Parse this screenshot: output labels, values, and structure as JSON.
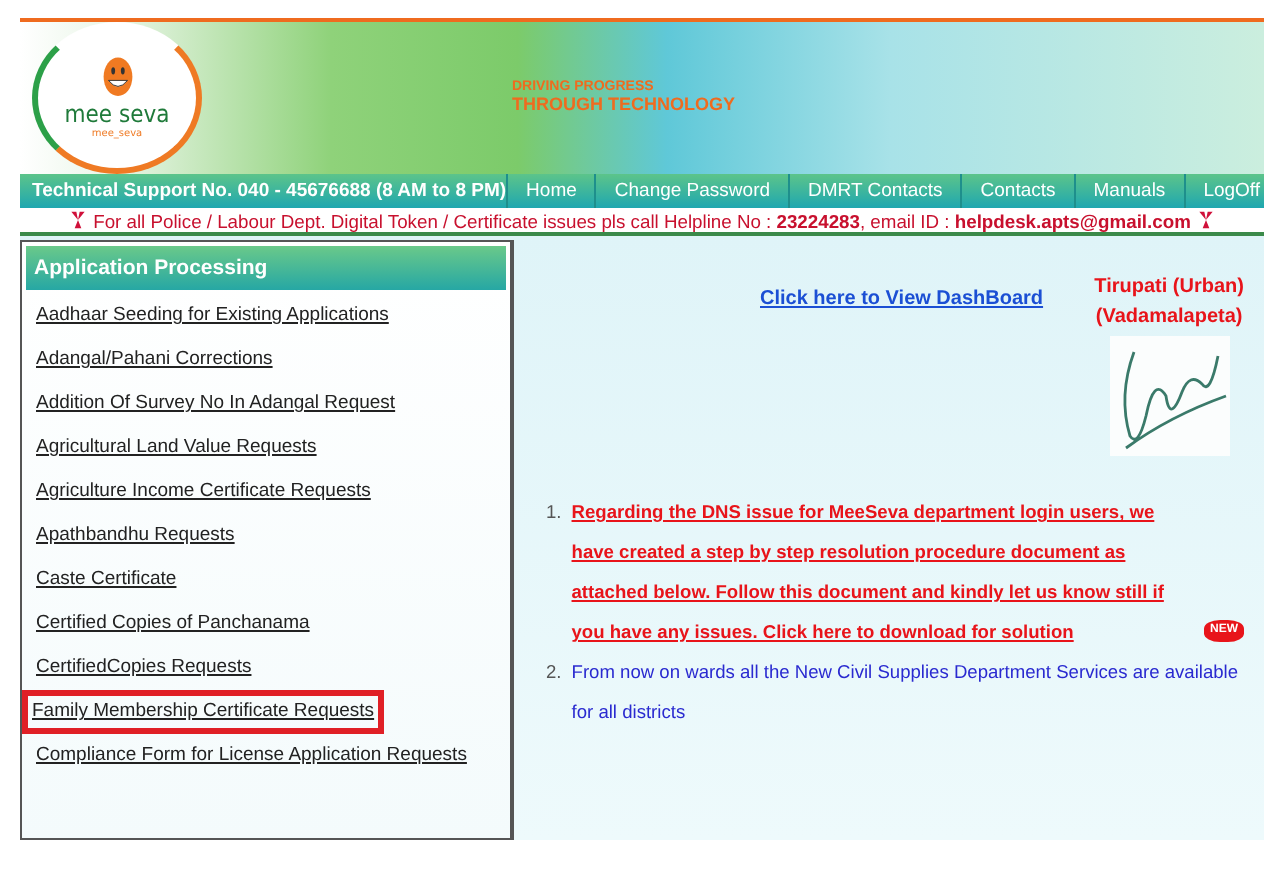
{
  "header": {
    "logo_text": "mee seva",
    "logo_tagline": "mee_seva",
    "slogan_line_1": "DRIVING PROGRESS",
    "slogan_line_2": "THROUGH TECHNOLOGY"
  },
  "nav": {
    "support": "Technical Support No. 040 - 45676688 (8 AM to 8 PM)",
    "links": [
      {
        "label": "Home"
      },
      {
        "label": "Change Password"
      },
      {
        "label": "DMRT Contacts"
      },
      {
        "label": "Contacts"
      },
      {
        "label": "Manuals"
      },
      {
        "label": "LogOff"
      }
    ]
  },
  "notice": {
    "text": "For all Police / Labour Dept. Digital Token / Certificate issues pls call Helpline No : **23224283**, email ID : **helpdesk.apts@gmail.com**"
  },
  "sidebar": {
    "title": "Application Processing",
    "items": [
      {
        "label": "Aadhaar Seeding for Existing Applications",
        "highlighted": false
      },
      {
        "label": "Adangal/Pahani Corrections",
        "highlighted": false
      },
      {
        "label": "Addition Of Survey No In Adangal Request",
        "highlighted": false
      },
      {
        "label": "Agricultural Land Value Requests",
        "highlighted": false
      },
      {
        "label": "Agriculture Income Certificate Requests",
        "highlighted": false
      },
      {
        "label": "Apathbandhu Requests",
        "highlighted": false
      },
      {
        "label": "Caste Certificate",
        "highlighted": false
      },
      {
        "label": "Certified Copies of Panchanama",
        "highlighted": false
      },
      {
        "label": "CertifiedCopies Requests",
        "highlighted": false
      },
      {
        "label": "Family Membership Certificate Requests",
        "highlighted": true
      },
      {
        "label": "Compliance Form for License Application Requests",
        "highlighted": false
      }
    ]
  },
  "main": {
    "dashboard_link": "Click here to View DashBoard",
    "location_line_1": "Tirupati (Urban)",
    "location_line_2": "(Vadamalapeta)",
    "announcements": [
      {
        "number": "1.",
        "kind": "alert",
        "text": "Regarding the DNS issue for MeeSeva department login users, we have created a step by step resolution procedure document as attached below. Follow this document and kindly let us know still if you have any issues. Click here to download for solution",
        "new_badge": "NEW"
      },
      {
        "number": "2.",
        "kind": "info",
        "text": "From now on wards all the New Civil Supplies Department Services are available for all districts"
      }
    ]
  }
}
